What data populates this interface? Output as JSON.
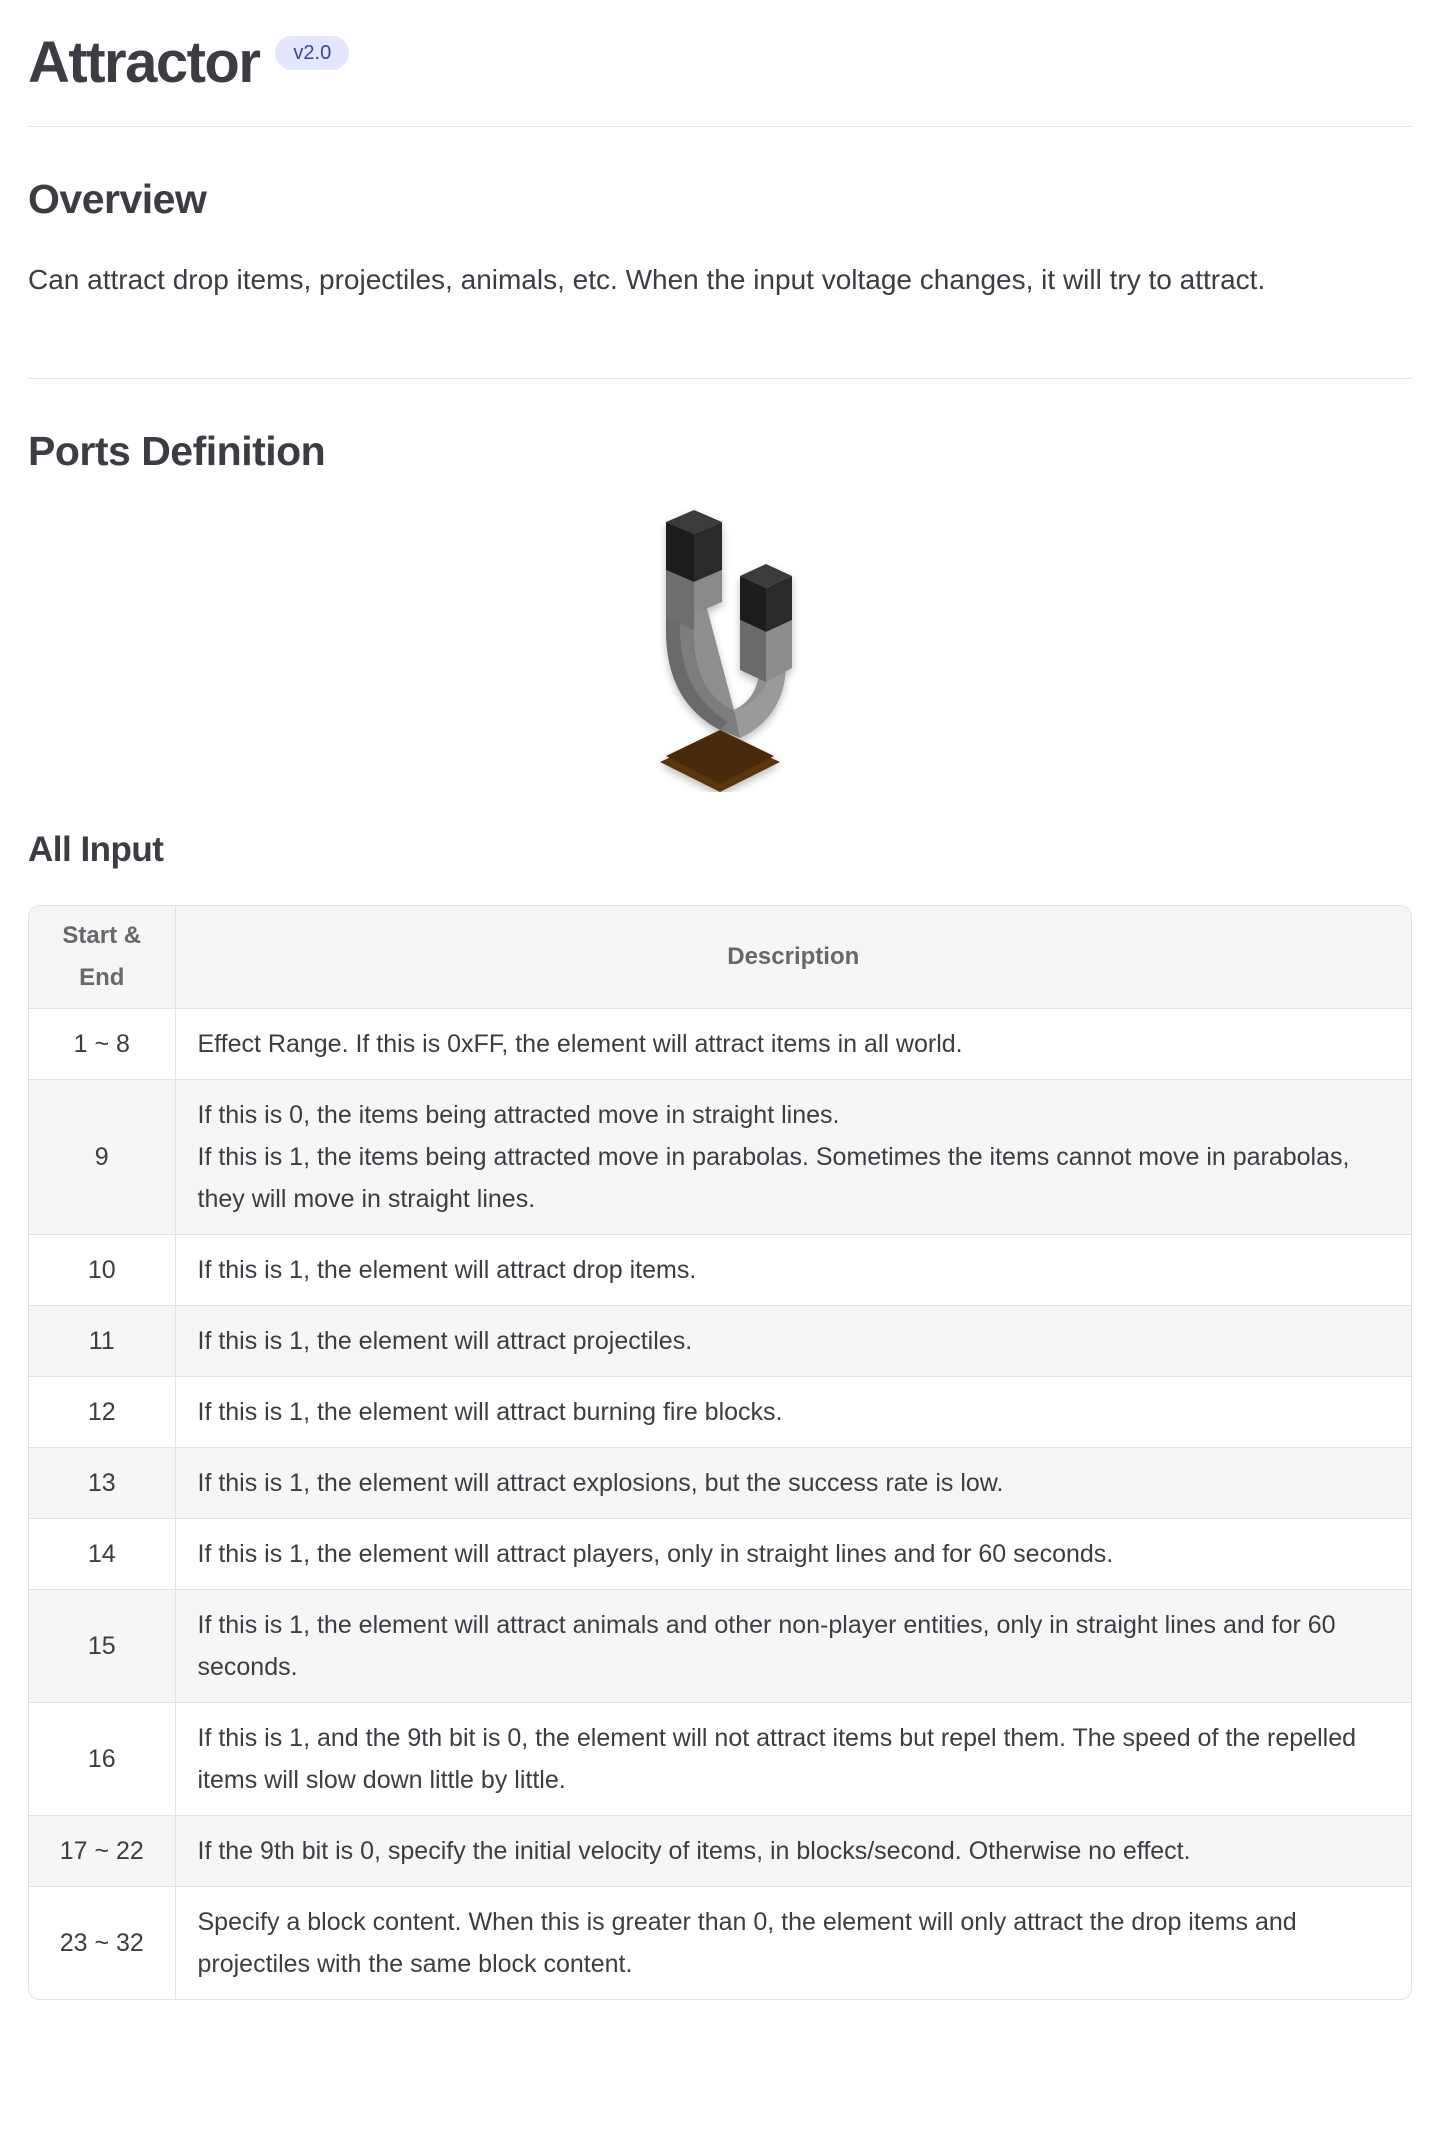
{
  "header": {
    "title": "Attractor",
    "version_badge": "v2.0"
  },
  "overview": {
    "heading": "Overview",
    "text": "Can attract drop items, projectiles, animals, etc. When the input voltage changes, it will try to attract."
  },
  "ports": {
    "heading": "Ports Definition",
    "figure_icon": "magnet-block-icon",
    "all_input": {
      "heading": "All Input",
      "columns": [
        "Start & End",
        "Description"
      ],
      "rows": [
        {
          "range": "1 ~ 8",
          "description": [
            "Effect Range. If this is 0xFF, the element will attract items in all world."
          ]
        },
        {
          "range": "9",
          "description": [
            "If this is 0, the items being attracted move in straight lines.",
            "If this is 1, the items being attracted move in parabolas. Sometimes the items cannot move in parabolas, they will move in straight lines."
          ]
        },
        {
          "range": "10",
          "description": [
            "If this is 1, the element will attract drop items."
          ]
        },
        {
          "range": "11",
          "description": [
            "If this is 1, the element will attract projectiles."
          ]
        },
        {
          "range": "12",
          "description": [
            "If this is 1, the element will attract burning fire blocks."
          ]
        },
        {
          "range": "13",
          "description": [
            "If this is 1, the element will attract explosions, but the success rate is low."
          ]
        },
        {
          "range": "14",
          "description": [
            "If this is 1, the element will attract players, only in straight lines and for 60 seconds."
          ]
        },
        {
          "range": "15",
          "description": [
            "If this is 1, the element will attract animals and other non-player entities, only in straight lines and for 60 seconds."
          ]
        },
        {
          "range": "16",
          "description": [
            "If this is 1, and the 9th bit is 0, the element will not attract items but repel them. The speed of the repelled items will slow down little by little."
          ]
        },
        {
          "range": "17 ~ 22",
          "description": [
            "If the 9th bit is 0, specify the initial velocity of items, in blocks/second. Otherwise no effect."
          ]
        },
        {
          "range": "23 ~ 32",
          "description": [
            "Specify a block content. When this is greater than 0, the element will only attract the drop items and projectiles with the same block content."
          ]
        }
      ]
    }
  }
}
